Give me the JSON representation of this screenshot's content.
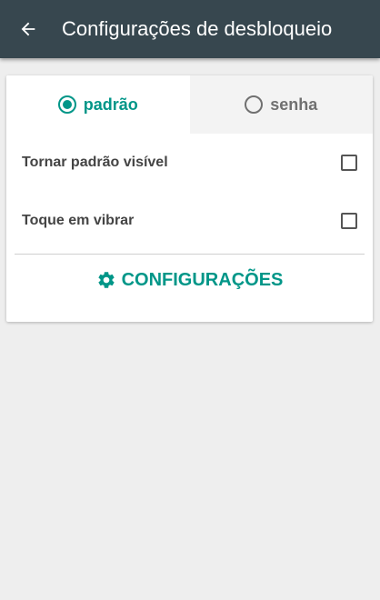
{
  "appbar": {
    "title": "Configurações de desbloqueio",
    "back_icon": "arrow-left-icon",
    "background": "#37474f"
  },
  "tabs": [
    {
      "label": "padrão",
      "selected": true
    },
    {
      "label": "senha",
      "selected": false
    }
  ],
  "options": [
    {
      "label": "Tornar padrão visível",
      "checked": false
    },
    {
      "label": "Toque em vibrar",
      "checked": false
    }
  ],
  "settings_button": {
    "label": "CONFIGURAÇÕES",
    "icon": "gear-icon"
  },
  "accent_color": "#009688"
}
